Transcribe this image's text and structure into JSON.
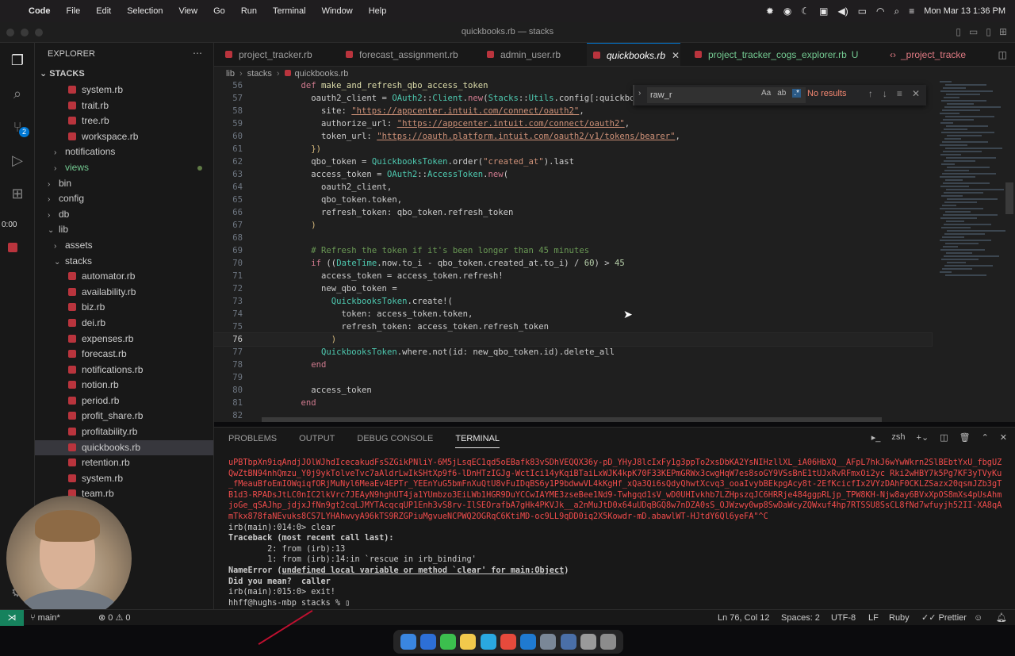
{
  "menubar": {
    "items": [
      "Code",
      "File",
      "Edit",
      "Selection",
      "View",
      "Go",
      "Run",
      "Terminal",
      "Window",
      "Help"
    ],
    "datetime": "Mon Mar 13  1:36 PM"
  },
  "window": {
    "title": "quickbooks.rb — stacks"
  },
  "sidebar": {
    "header": "EXPLORER",
    "section": "STACKS",
    "rows": [
      {
        "label": "system.rb",
        "kind": "file",
        "indent": 3
      },
      {
        "label": "trait.rb",
        "kind": "file",
        "indent": 3
      },
      {
        "label": "tree.rb",
        "kind": "file",
        "indent": 3
      },
      {
        "label": "workspace.rb",
        "kind": "file",
        "indent": 3
      },
      {
        "label": "notifications",
        "kind": "folder",
        "indent": 2
      },
      {
        "label": "views",
        "kind": "folder",
        "indent": 2
      },
      {
        "label": "bin",
        "kind": "folder",
        "indent": 1
      },
      {
        "label": "config",
        "kind": "folder",
        "indent": 1
      },
      {
        "label": "db",
        "kind": "folder",
        "indent": 1
      },
      {
        "label": "lib",
        "kind": "folder-open",
        "indent": 1
      },
      {
        "label": "assets",
        "kind": "folder",
        "indent": 2
      },
      {
        "label": "stacks",
        "kind": "folder-open",
        "indent": 2
      },
      {
        "label": "automator.rb",
        "kind": "file",
        "indent": 3
      },
      {
        "label": "availability.rb",
        "kind": "file",
        "indent": 3
      },
      {
        "label": "biz.rb",
        "kind": "file",
        "indent": 3
      },
      {
        "label": "dei.rb",
        "kind": "file",
        "indent": 3
      },
      {
        "label": "expenses.rb",
        "kind": "file",
        "indent": 3
      },
      {
        "label": "forecast.rb",
        "kind": "file",
        "indent": 3
      },
      {
        "label": "notifications.rb",
        "kind": "file",
        "indent": 3
      },
      {
        "label": "notion.rb",
        "kind": "file",
        "indent": 3
      },
      {
        "label": "period.rb",
        "kind": "file",
        "indent": 3
      },
      {
        "label": "profit_share.rb",
        "kind": "file",
        "indent": 3
      },
      {
        "label": "profitability.rb",
        "kind": "file",
        "indent": 3
      },
      {
        "label": "quickbooks.rb",
        "kind": "file",
        "indent": 3,
        "selected": true
      },
      {
        "label": "retention.rb",
        "kind": "file",
        "indent": 3
      },
      {
        "label": "system.rb",
        "kind": "file",
        "indent": 3
      },
      {
        "label": "team.rb",
        "kind": "file",
        "indent": 3
      }
    ],
    "timer": "0:00"
  },
  "tabs": [
    {
      "label": "project_tracker.rb"
    },
    {
      "label": "forecast_assignment.rb"
    },
    {
      "label": "admin_user.rb"
    },
    {
      "label": "quickbooks.rb",
      "active": true
    },
    {
      "label": "project_tracker_cogs_explorer.rb",
      "git": "U"
    },
    {
      "label": "_project_tracke"
    }
  ],
  "breadcrumb": [
    "lib",
    "stacks",
    "quickbooks.rb"
  ],
  "find": {
    "value": "raw_r",
    "opt1": "Aa",
    "opt2": "ab",
    "opt3": ".*",
    "result": "No results"
  },
  "code": [
    {
      "n": "56",
      "html": "    <span class='tok-k'>def</span> <span class='tok-f'>make_and_refresh_qbo_access_token</span>"
    },
    {
      "n": "57",
      "html": "      oauth2_client = <span class='tok-c'>OAuth2</span>::<span class='tok-c'>Client</span>.<span class='tok-k'>new</span>(<span class='tok-c'>Stacks</span>::<span class='tok-c'>Utils</span>.config[:quickbooks"
    },
    {
      "n": "58",
      "html": "        site: <span class='tok-s'>\"https://appcenter.intuit.com/connect/oauth2\"</span>,"
    },
    {
      "n": "59",
      "html": "        authorize_url: <span class='tok-s'>\"https://appcenter.intuit.com/connect/oauth2\"</span>,"
    },
    {
      "n": "60",
      "html": "        token_url: <span class='tok-s'>\"https://oauth.platform.intuit.com/oauth2/v1/tokens/bearer\"</span>,"
    },
    {
      "n": "61",
      "html": "      <span class='tok-p'>})</span>"
    },
    {
      "n": "62",
      "html": "      qbo_token = <span class='tok-c'>QuickbooksToken</span>.order(<span class='tok-s2'>\"created_at\"</span>).last"
    },
    {
      "n": "63",
      "html": "      access_token = <span class='tok-c'>OAuth2</span>::<span class='tok-c'>AccessToken</span>.<span class='tok-k'>new</span>("
    },
    {
      "n": "64",
      "html": "        oauth2_client,"
    },
    {
      "n": "65",
      "html": "        qbo_token.token,"
    },
    {
      "n": "66",
      "html": "        refresh_token: qbo_token.refresh_token"
    },
    {
      "n": "67",
      "html": "      <span class='tok-p'>)</span>"
    },
    {
      "n": "68",
      "html": ""
    },
    {
      "n": "69",
      "html": "      <span class='tok-cm'># Refresh the token if it's been longer than 45 minutes</span>"
    },
    {
      "n": "70",
      "html": "      <span class='tok-k'>if</span> ((<span class='tok-c'>DateTime</span>.now.to_i - qbo_token.created_at.to_i) / <span class='tok-n'>60</span>) &gt; <span class='tok-n'>45</span>"
    },
    {
      "n": "71",
      "html": "        access_token = access_token.refresh!"
    },
    {
      "n": "72",
      "html": "        new_qbo_token ="
    },
    {
      "n": "73",
      "html": "          <span class='tok-c'>QuickbooksToken</span>.create!("
    },
    {
      "n": "74",
      "html": "            token: access_token.token,"
    },
    {
      "n": "75",
      "html": "            refresh_token: access_token.refresh_token"
    },
    {
      "n": "76",
      "html": "          <span class='tok-p'>)</span>",
      "current": true
    },
    {
      "n": "77",
      "html": "        <span class='tok-c'>QuickbooksToken</span>.where.not(id: new_qbo_token.id).delete_all"
    },
    {
      "n": "78",
      "html": "      <span class='tok-k'>end</span>"
    },
    {
      "n": "79",
      "html": ""
    },
    {
      "n": "80",
      "html": "      access_token"
    },
    {
      "n": "81",
      "html": "    <span class='tok-k'>end</span>"
    },
    {
      "n": "82",
      "html": ""
    }
  ],
  "panel": {
    "tabs": [
      "PROBLEMS",
      "OUTPUT",
      "DEBUG CONSOLE",
      "TERMINAL"
    ],
    "active_tab": "TERMINAL",
    "shell": "zsh"
  },
  "terminal": {
    "token_blob": "uPBTbpXn9iqAndjJOlWJhdIcecakudFsSZGikPNliY-6M5jLsqEC1qd5oEBafk83vSDhVEQQX36y-pD_YHyJ8lcIxFy1g3ppTo2xsDbKA2YsNIHzllXL_iA06HbXQ__AFpL7hkJ6wYwWkrn2SlBEbtYxU_fbgUZQwZtBN94nhQmzu_Y0j9ykTolveTvc7aAldrLwIkSHtXp9f6-lDnHTzIGJg-WctIci14yKqiBTaiLxWJK4kpK70F33KEPmGRWx3cwgHqW7es8soGY9VSsBnE1tUJxRvRFmxOi2yc Rki2wHBY7k5Pg7KF3yTVyKu_fMeauBfoEmIOWqiqfORjMuNyl6MeaEv4EPTr_YEEnYuG5bmFnXuQtU8vFuIDqBS6y1P9bdwwVL4kKgHf_xQa3Qi6sQdyQhwtXcvq3_ooaIvybBEkpgAcy8t-2EfKcicfIx2VYzDAhF0CKLZSazx20qsmJZb3gTB1d3-RPADsJtLC0nIC2lkVrc7JEAyN9hghUT4ja1YUmbzo3EiLWb1HGR9DuYCCwIAYME3zseBee1Nd9-Twhgqd1sV_wD0UHIvkhb7LZHpszqJC6HRRje484ggpRLjp_TPW8KH-Njw8ay6BVxXpOS8mXs4pUsAhmjoGe_qSAJhp_jdjxJfNn9gt2cqLJMYTAcqcqUP1Enh3vS8rv-IlSEOrafbA7gHk4PKVJk__a2nMuJtD0x64uUDqBGQ8w7nDZA0sS_OJWzwy0wp8SwDaWcyZQWxuf4hp7RTSSU8SsCL8fNd7wfuyjh52II-XA8qAmTkx878faNEvuks8CS7LYHAhwvyA96kTS9RZGPiuMgvueNCPWQ2OGRqC6KtiMD-oc9LL9qDD0iq2X5Kowdr-mD.abawlWT-HJtdY6Ql6yeFA\"^C",
    "lines": [
      {
        "text": "irb(main):014:0> clear",
        "style": ""
      },
      {
        "text": "Traceback (most recent call last):",
        "style": "b"
      },
      {
        "text": "        2: from (irb):13",
        "style": ""
      },
      {
        "text": "        1: from (irb):14:in `rescue in irb_binding'",
        "style": ""
      },
      {
        "text": "NameError (undefined local variable or method `clear' for main:Object)",
        "style": "err"
      },
      {
        "text": "Did you mean?  caller",
        "style": "b"
      },
      {
        "text": "irb(main):015:0> exit!",
        "style": ""
      },
      {
        "text": "hhff@hughs-mbp stacks % ▯",
        "style": ""
      }
    ]
  },
  "statusbar": {
    "branch": "main*",
    "problems": "⊗ 0 ⚠ 0",
    "position": "Ln 76, Col 12",
    "spaces": "Spaces: 2",
    "encoding": "UTF-8",
    "eol": "LF",
    "language": "Ruby",
    "formatter": "Prettier"
  }
}
